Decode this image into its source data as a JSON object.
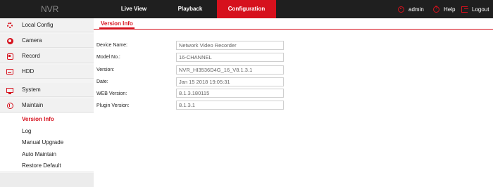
{
  "app": {
    "brand": "NVR"
  },
  "topnav": {
    "items": [
      {
        "label": "Live View"
      },
      {
        "label": "Playback"
      },
      {
        "label": "Configuration",
        "active": true
      }
    ],
    "user": "admin",
    "help": "Help",
    "logout": "Logout"
  },
  "sidebar": {
    "items": [
      {
        "label": "Local Config",
        "icon": "gear-icon"
      },
      {
        "label": "Camera",
        "icon": "camera-icon"
      },
      {
        "label": "Record",
        "icon": "record-icon"
      },
      {
        "label": "HDD",
        "icon": "hdd-icon"
      },
      {
        "label": "System",
        "icon": "monitor-icon"
      },
      {
        "label": "Maintain",
        "icon": "info-icon"
      }
    ],
    "sub_items": [
      {
        "label": "Version Info",
        "active": true
      },
      {
        "label": "Log"
      },
      {
        "label": "Manual Upgrade"
      },
      {
        "label": "Auto Maintain"
      },
      {
        "label": "Restore Default"
      }
    ]
  },
  "main": {
    "tab": "Version Info",
    "fields": [
      {
        "label": "Device Name:",
        "value": "Network Video Recorder"
      },
      {
        "label": "Model No.:",
        "value": "16-CHANNEL"
      },
      {
        "label": "Version:",
        "value": "NVR_HI3536D4G_16_V8.1.3.1"
      },
      {
        "label": "Date:",
        "value": "Jan 15 2018   19:05:31"
      },
      {
        "label": "WEB Version:",
        "value": "8.1.3.180115"
      },
      {
        "label": "Plugin Version:",
        "value": "8.1.3.1"
      }
    ]
  },
  "colors": {
    "accent": "#d6111d",
    "topbar": "#1f1f1f",
    "sidebar": "#f1f1f1"
  }
}
